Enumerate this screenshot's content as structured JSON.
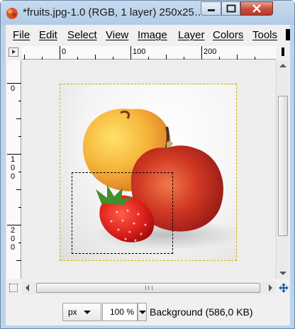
{
  "window": {
    "title": "*fruits.jpg-1.0 (RGB, 1 layer) 250x25…"
  },
  "menu": {
    "items": [
      "File",
      "Edit",
      "Select",
      "View",
      "Image",
      "Layer",
      "Colors",
      "Tools"
    ]
  },
  "rulers": {
    "horizontal_labels": [
      "0",
      "100",
      "200"
    ],
    "vertical_labels": [
      [
        "0"
      ],
      [
        "1",
        "0",
        "0"
      ],
      [
        "2",
        "0",
        "0"
      ]
    ]
  },
  "statusbar": {
    "unit": "px",
    "zoom": "100 %",
    "layer_info": "Background (586,0 KB)"
  },
  "colors": {
    "image_border": "#c8b400",
    "close_button": "#c74d3a"
  },
  "icons": {
    "app": "gimp-wilber-icon",
    "navigate": "navigate-icon",
    "quick_mask": "quick-mask-icon"
  }
}
